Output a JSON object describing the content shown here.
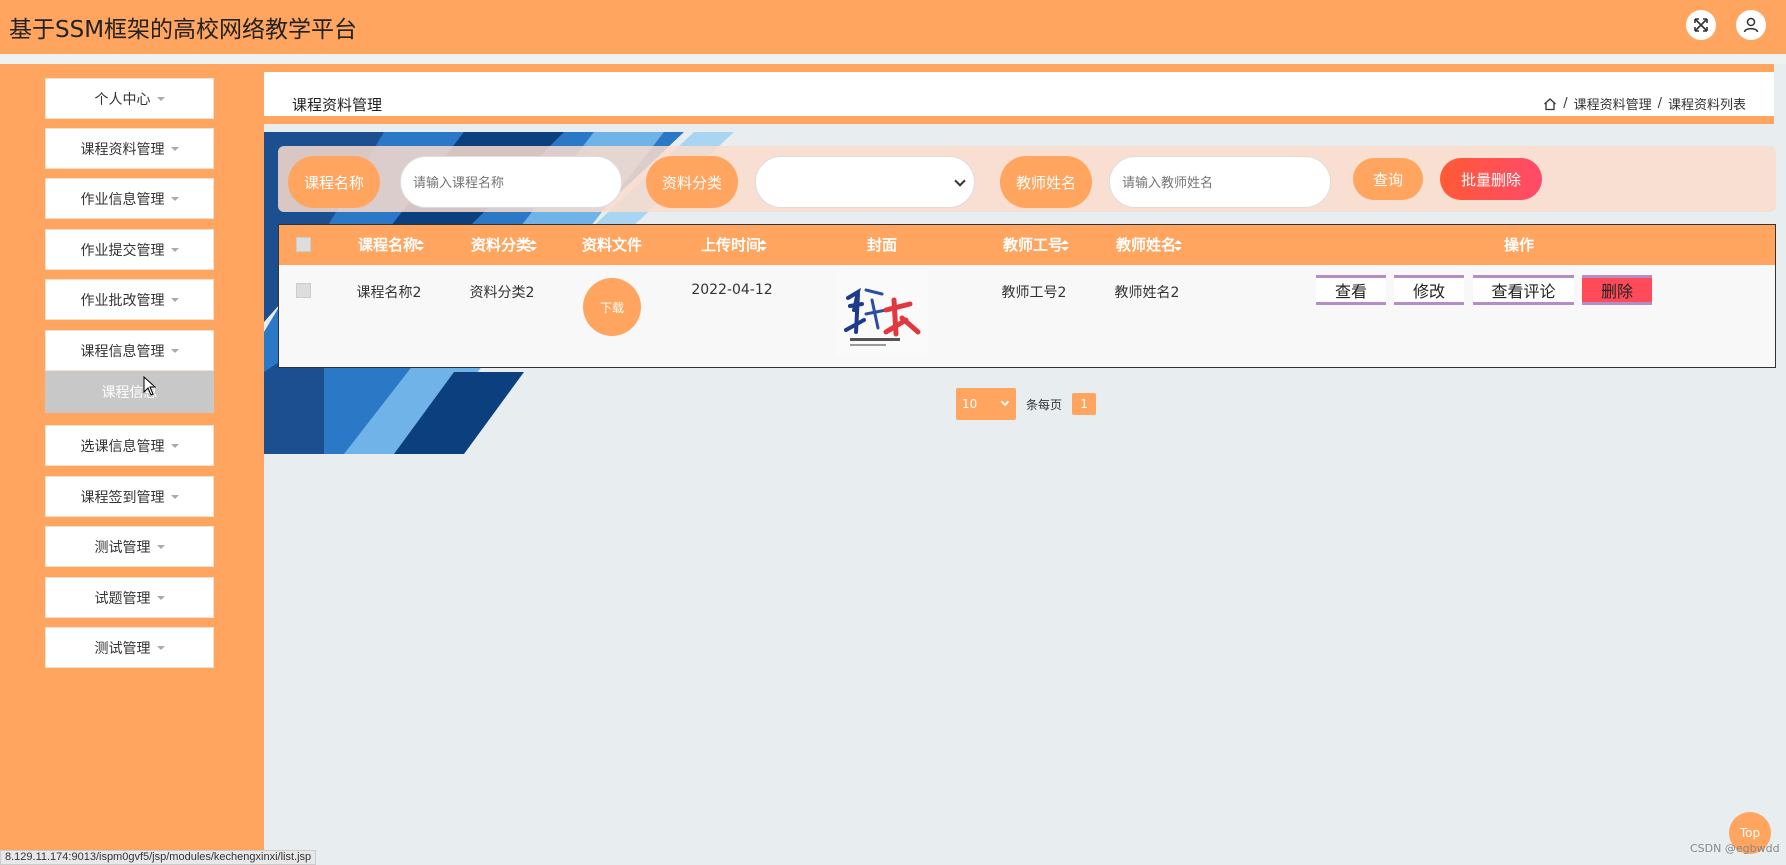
{
  "header": {
    "title": "基于SSM框架的高校网络教学平台"
  },
  "sidebar": {
    "items": [
      {
        "label": "个人中心"
      },
      {
        "label": "课程资料管理"
      },
      {
        "label": "作业信息管理"
      },
      {
        "label": "作业提交管理"
      },
      {
        "label": "作业批改管理"
      },
      {
        "label": "课程信息管理"
      },
      {
        "label": "选课信息管理"
      },
      {
        "label": "课程签到管理"
      },
      {
        "label": "测试管理"
      },
      {
        "label": "试题管理"
      },
      {
        "label": "测试管理"
      }
    ],
    "submenu_label": "课程信息"
  },
  "page": {
    "title": "课程资料管理",
    "breadcrumb": [
      "课程资料管理",
      "课程资料列表"
    ],
    "breadcrumb_sep": "/"
  },
  "search": {
    "course_label": "课程名称",
    "course_placeholder": "请输入课程名称",
    "category_label": "资料分类",
    "teacher_label": "教师姓名",
    "teacher_placeholder": "请输入教师姓名",
    "query_label": "查询",
    "batch_delete_label": "批量删除"
  },
  "table": {
    "headers": [
      "课程名称",
      "资料分类",
      "资料文件",
      "上传时间",
      "封面",
      "教师工号",
      "教师姓名",
      "操作"
    ],
    "rows": [
      {
        "course": "课程名称2",
        "category": "资料分类2",
        "download": "下载",
        "time": "2022-04-12",
        "teacher_id": "教师工号2",
        "teacher_name": "教师姓名2",
        "actions": [
          "查看",
          "修改",
          "查看评论",
          "删除"
        ]
      }
    ]
  },
  "pager": {
    "page_size": "10",
    "per_page_label": "条每页",
    "current": "1"
  },
  "misc": {
    "top_label": "Top",
    "watermark": "CSDN @egbwdd",
    "status_url": "8.129.11.174:9013/ispm0gvf5/jsp/modules/kechengxinxi/list.jsp"
  },
  "colors": {
    "accent": "#ffa55f",
    "danger": "#ff4a5a"
  }
}
